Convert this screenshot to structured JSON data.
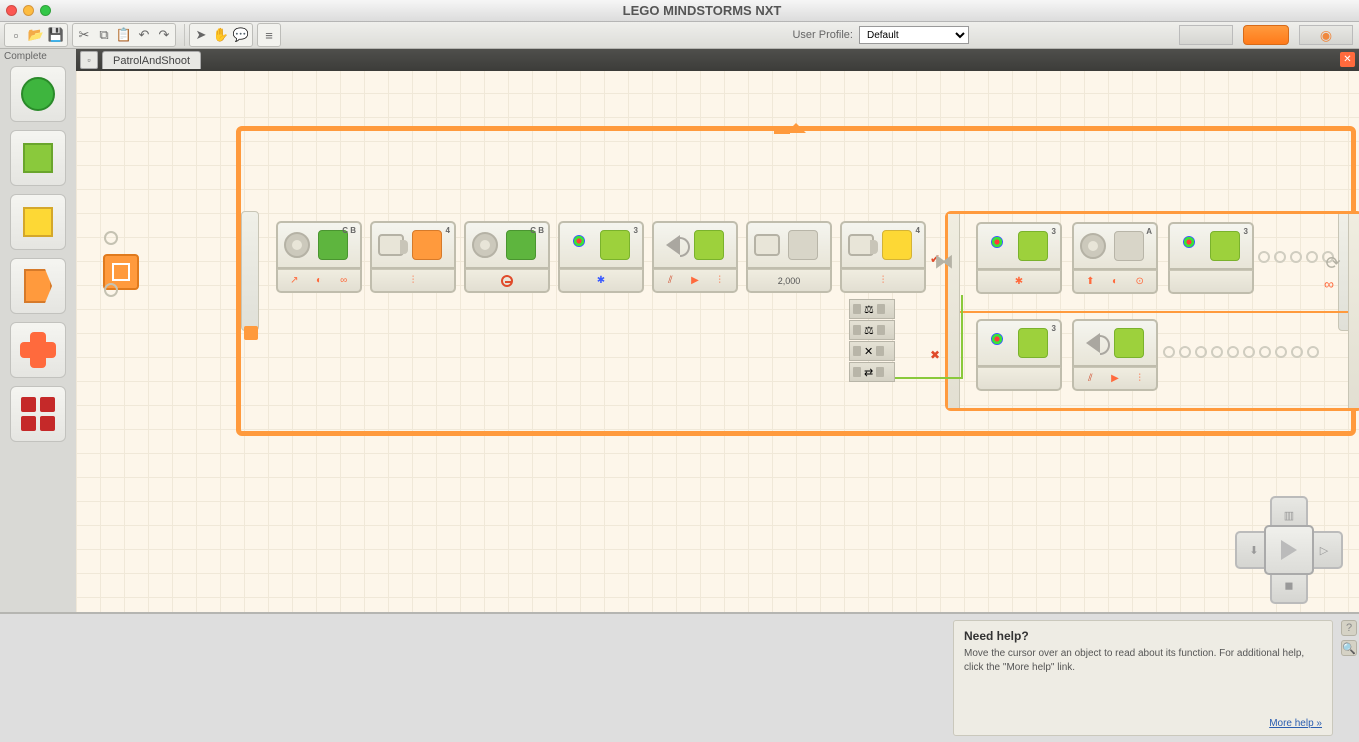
{
  "app_title": "LEGO MINDSTORMS NXT",
  "user_profile_label": "User Profile:",
  "user_profile_value": "Default",
  "palette_label": "Complete",
  "tab_name": "PatrolAndShoot",
  "blocks": {
    "move1_ports": "C B",
    "sensor1_port": "4",
    "move2_ports": "C B",
    "light1_port": "3",
    "sound1_port": "",
    "wait_value": "2,000",
    "sensor2_port": "4",
    "sw_light1_port": "3",
    "sw_motor_port": "A",
    "sw_light2_port": "3",
    "sw_light3_port": "3"
  },
  "help": {
    "title": "Need help?",
    "body": "Move the cursor over an object to read about its function. For additional help, click the \"More help\" link.",
    "link": "More help »"
  }
}
